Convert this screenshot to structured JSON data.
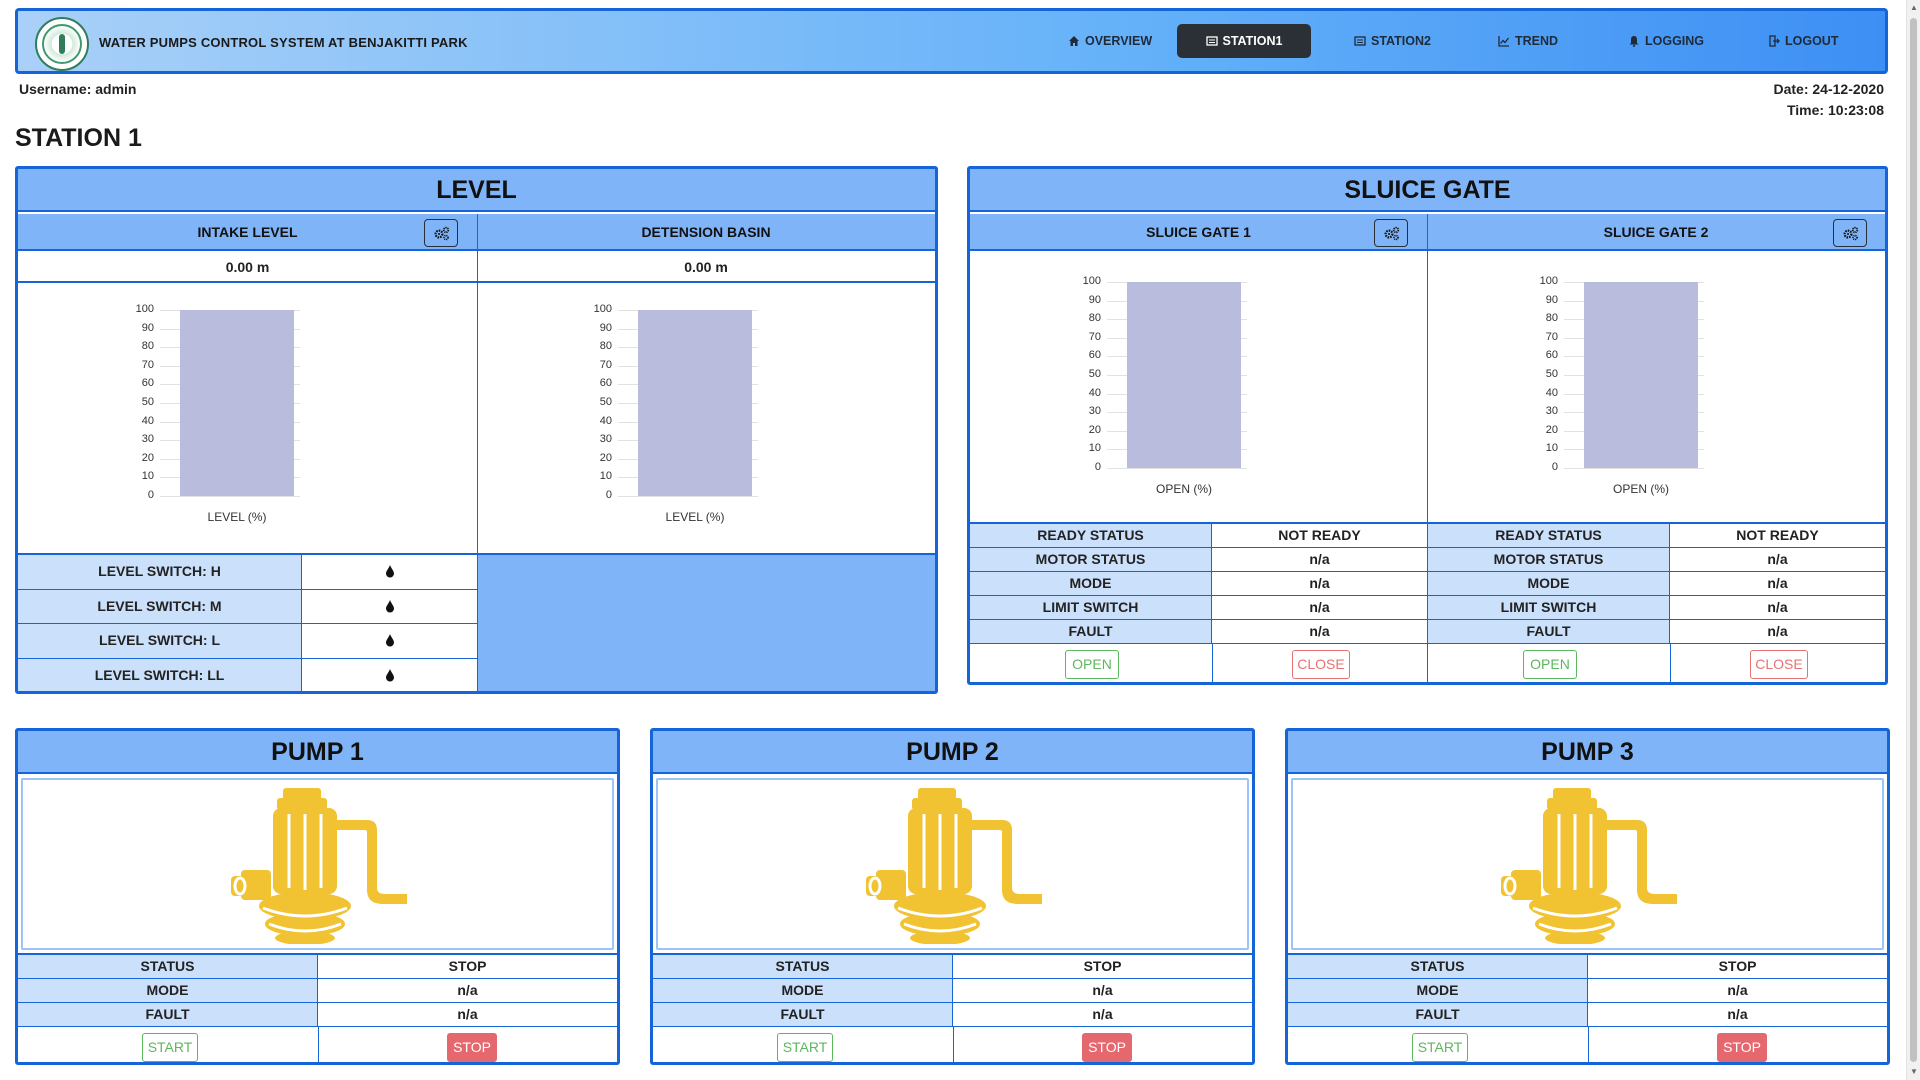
{
  "header": {
    "brand": "WATER PUMPS CONTROL SYSTEM AT BENJAKITTI PARK",
    "nav": [
      {
        "label": "OVERVIEW",
        "icon": "home-icon"
      },
      {
        "label": "STATION1",
        "icon": "list-icon",
        "active": true
      },
      {
        "label": "STATION2",
        "icon": "list-icon"
      },
      {
        "label": "TREND",
        "icon": "line-chart-icon"
      },
      {
        "label": "LOGGING",
        "icon": "bell-icon"
      },
      {
        "label": "LOGOUT",
        "icon": "logout-icon"
      }
    ]
  },
  "user": {
    "username": "Username: admin",
    "date": "Date: 24-12-2020",
    "time": "Time: 10:23:08"
  },
  "station_title": "STATION 1",
  "level": {
    "title": "LEVEL",
    "intake": {
      "title": "INTAKE LEVEL",
      "value": "0.00 m",
      "xlabel": "LEVEL (%)",
      "percent": 100
    },
    "basin": {
      "title": "DETENSION BASIN",
      "value": "0.00 m",
      "xlabel": "LEVEL (%)",
      "percent": 100
    },
    "switches": [
      {
        "label": "LEVEL SWITCH: H",
        "icon": "drop-icon"
      },
      {
        "label": "LEVEL SWITCH: M",
        "icon": "drop-icon"
      },
      {
        "label": "LEVEL SWITCH: L",
        "icon": "drop-icon"
      },
      {
        "label": "LEVEL SWITCH: LL",
        "icon": "drop-icon"
      }
    ]
  },
  "sluice": {
    "title": "SLUICE GATE",
    "gates": [
      {
        "title": "SLUICE GATE 1",
        "xlabel": "OPEN (%)",
        "percent": 100,
        "rows": [
          [
            "READY STATUS",
            "NOT READY"
          ],
          [
            "MOTOR STATUS",
            "n/a"
          ],
          [
            "MODE",
            "n/a"
          ],
          [
            "LIMIT SWITCH",
            "n/a"
          ],
          [
            "FAULT",
            "n/a"
          ]
        ],
        "open_label": "OPEN",
        "close_label": "CLOSE"
      },
      {
        "title": "SLUICE GATE 2",
        "xlabel": "OPEN (%)",
        "percent": 100,
        "rows": [
          [
            "READY STATUS",
            "NOT READY"
          ],
          [
            "MOTOR STATUS",
            "n/a"
          ],
          [
            "MODE",
            "n/a"
          ],
          [
            "LIMIT SWITCH",
            "n/a"
          ],
          [
            "FAULT",
            "n/a"
          ]
        ],
        "open_label": "OPEN",
        "close_label": "CLOSE"
      }
    ]
  },
  "pumps": [
    {
      "title": "PUMP 1",
      "rows": [
        [
          "STATUS",
          "STOP"
        ],
        [
          "MODE",
          "n/a"
        ],
        [
          "FAULT",
          "n/a"
        ]
      ],
      "start_label": "START",
      "stop_label": "STOP"
    },
    {
      "title": "PUMP 2",
      "rows": [
        [
          "STATUS",
          "STOP"
        ],
        [
          "MODE",
          "n/a"
        ],
        [
          "FAULT",
          "n/a"
        ]
      ],
      "start_label": "START",
      "stop_label": "STOP"
    },
    {
      "title": "PUMP 3",
      "rows": [
        [
          "STATUS",
          "STOP"
        ],
        [
          "MODE",
          "n/a"
        ],
        [
          "FAULT",
          "n/a"
        ]
      ],
      "start_label": "START",
      "stop_label": "STOP"
    }
  ],
  "chart_data": [
    {
      "type": "bar",
      "categories": [
        ""
      ],
      "values": [
        100
      ],
      "xlabel": "LEVEL (%)",
      "ylim": [
        0,
        100
      ],
      "yticks": [
        0,
        10,
        20,
        30,
        40,
        50,
        60,
        70,
        80,
        90,
        100
      ]
    },
    {
      "type": "bar",
      "categories": [
        ""
      ],
      "values": [
        100
      ],
      "xlabel": "LEVEL (%)",
      "ylim": [
        0,
        100
      ],
      "yticks": [
        0,
        10,
        20,
        30,
        40,
        50,
        60,
        70,
        80,
        90,
        100
      ]
    },
    {
      "type": "bar",
      "categories": [
        ""
      ],
      "values": [
        100
      ],
      "xlabel": "OPEN (%)",
      "ylim": [
        0,
        100
      ],
      "yticks": [
        0,
        10,
        20,
        30,
        40,
        50,
        60,
        70,
        80,
        90,
        100
      ]
    },
    {
      "type": "bar",
      "categories": [
        ""
      ],
      "values": [
        100
      ],
      "xlabel": "OPEN (%)",
      "ylim": [
        0,
        100
      ],
      "yticks": [
        0,
        10,
        20,
        30,
        40,
        50,
        60,
        70,
        80,
        90,
        100
      ]
    }
  ],
  "colors": {
    "panel_border": "#1565d8",
    "panel_header": "#80b4f8",
    "key_cell": "#cbe0fa",
    "bar": "#b9bcdc",
    "pump": "#f1c232",
    "stop_button": "#e5686f"
  }
}
